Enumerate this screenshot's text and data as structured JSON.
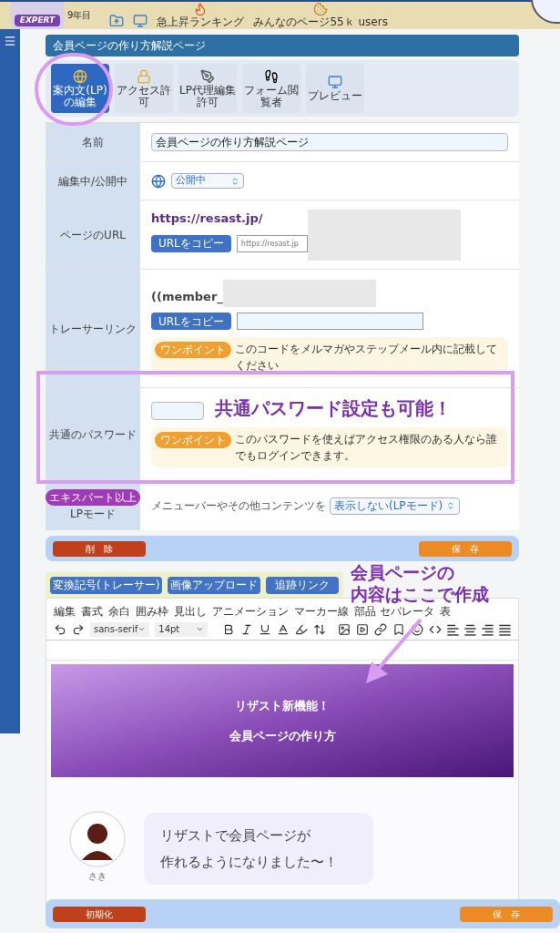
{
  "header": {
    "badge": "EXPERT",
    "years": "9年目",
    "nav": [
      {
        "kind": "folder"
      },
      {
        "kind": "monitor"
      },
      {
        "kind": "fire",
        "label": "急上昇ランキング"
      },
      {
        "kind": "cookies",
        "label": "みんなのページ55ｋ users"
      }
    ]
  },
  "page_title": "会員ページの作り方解説ページ",
  "tabs": [
    {
      "kind": "doc",
      "label": "案内文(LP)の編集",
      "selected": true
    },
    {
      "kind": "lock",
      "label": "アクセス許可",
      "selected": false
    },
    {
      "kind": "pen",
      "label": "LP代理編集許可",
      "selected": false
    },
    {
      "kind": "foot",
      "label": "フォーム閲覧者",
      "selected": false
    },
    {
      "kind": "monitor",
      "label": "プレビュー",
      "selected": false
    }
  ],
  "form": {
    "name": {
      "label": "名前",
      "value": "会員ページの作り方解説ページ"
    },
    "status": {
      "label": "編集中/公開中",
      "value": "公開中"
    },
    "url": {
      "label": "ページのURL",
      "link": "https://resast.jp/",
      "copy": "URLをコピー",
      "field": "https://resast.jp"
    },
    "tracer": {
      "label": "トレーサーリンク",
      "code": "((member_",
      "copy": "URLをコピー",
      "tip_badge": "ワンポイント",
      "tip": "このコードをメルマガやステップメール内に記載してください"
    },
    "password": {
      "label": "共通のパスワード",
      "tip_badge": "ワンポイント",
      "tip": "このパスワードを使えばアクセス権限のある人なら誰でもログインできます。"
    },
    "lp_mode": {
      "badge": "エキスパート以上",
      "label": "LPモード",
      "prefix": "メニューバーやその他コンテンツを",
      "value": "表示しない(LPモード)"
    }
  },
  "actions": {
    "delete": "削　除",
    "save": "保　存"
  },
  "editor": {
    "buttons": [
      "変換記号(トレーサー)",
      "画像アップロード",
      "追跡リンク"
    ],
    "menu": [
      "編集",
      "書式",
      "余白",
      "囲み枠",
      "見出し",
      "アニメーション",
      "マーカー線",
      "部品 セパレータ",
      "表"
    ],
    "font": "sans-serif",
    "size": "14pt",
    "banner": [
      "リザスト新機能！",
      "会員ページの作り方"
    ],
    "chat": {
      "name": "さき",
      "lines": [
        "リザストで会員ページが",
        "作れるようになりました〜！"
      ]
    }
  },
  "footer": {
    "reset": "初期化",
    "save": "保　存"
  },
  "annotations": {
    "password": "共通パスワード設定も可能！",
    "editor": [
      "会員ページの",
      "内容はここで作成"
    ]
  }
}
